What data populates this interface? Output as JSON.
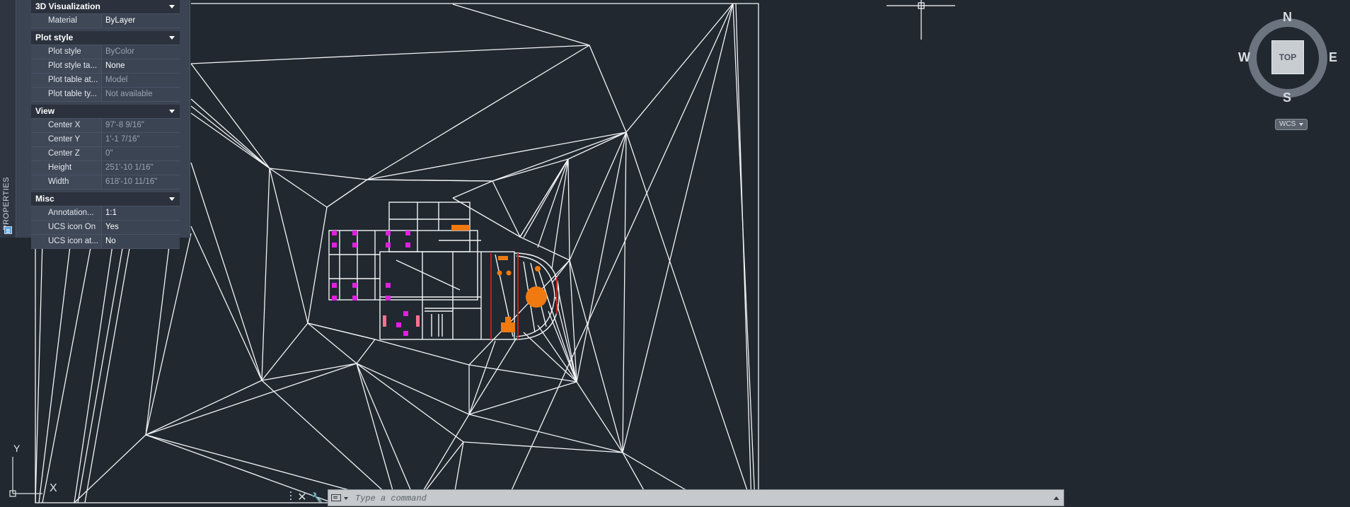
{
  "properties_palette": {
    "title": "PROPERTIES",
    "sections": [
      {
        "name": "3D Visualization",
        "rows": [
          {
            "label": "Material",
            "value": "ByLayer",
            "muted": false
          }
        ]
      },
      {
        "name": "Plot style",
        "rows": [
          {
            "label": "Plot style",
            "value": "ByColor",
            "muted": true
          },
          {
            "label": "Plot style ta...",
            "value": "None",
            "muted": false
          },
          {
            "label": "Plot table at...",
            "value": "Model",
            "muted": true
          },
          {
            "label": "Plot table ty...",
            "value": "Not available",
            "muted": true
          }
        ]
      },
      {
        "name": "View",
        "rows": [
          {
            "label": "Center X",
            "value": "97'-8 9/16\"",
            "muted": true
          },
          {
            "label": "Center Y",
            "value": "1'-1 7/16\"",
            "muted": true
          },
          {
            "label": "Center Z",
            "value": "0\"",
            "muted": true
          },
          {
            "label": "Height",
            "value": "251'-10 1/16\"",
            "muted": true
          },
          {
            "label": "Width",
            "value": "618'-10 11/16\"",
            "muted": true
          }
        ]
      },
      {
        "name": "Misc",
        "rows": [
          {
            "label": "Annotation...",
            "value": "1:1",
            "muted": false
          },
          {
            "label": "UCS icon On",
            "value": "Yes",
            "muted": false
          },
          {
            "label": "UCS icon at...",
            "value": "No",
            "muted": false
          }
        ]
      }
    ]
  },
  "viewcube": {
    "face": "TOP",
    "north": "N",
    "south": "S",
    "east": "E",
    "west": "W",
    "wcs_label": "WCS"
  },
  "ucs": {
    "x_label": "X",
    "y_label": "Y"
  },
  "command_line": {
    "placeholder": "Type a command"
  },
  "colors": {
    "background": "#212830",
    "linework": "#ffffff",
    "walls_magenta": "#e020e0",
    "furniture_orange": "#f07a10",
    "accent_red": "#c02020"
  }
}
